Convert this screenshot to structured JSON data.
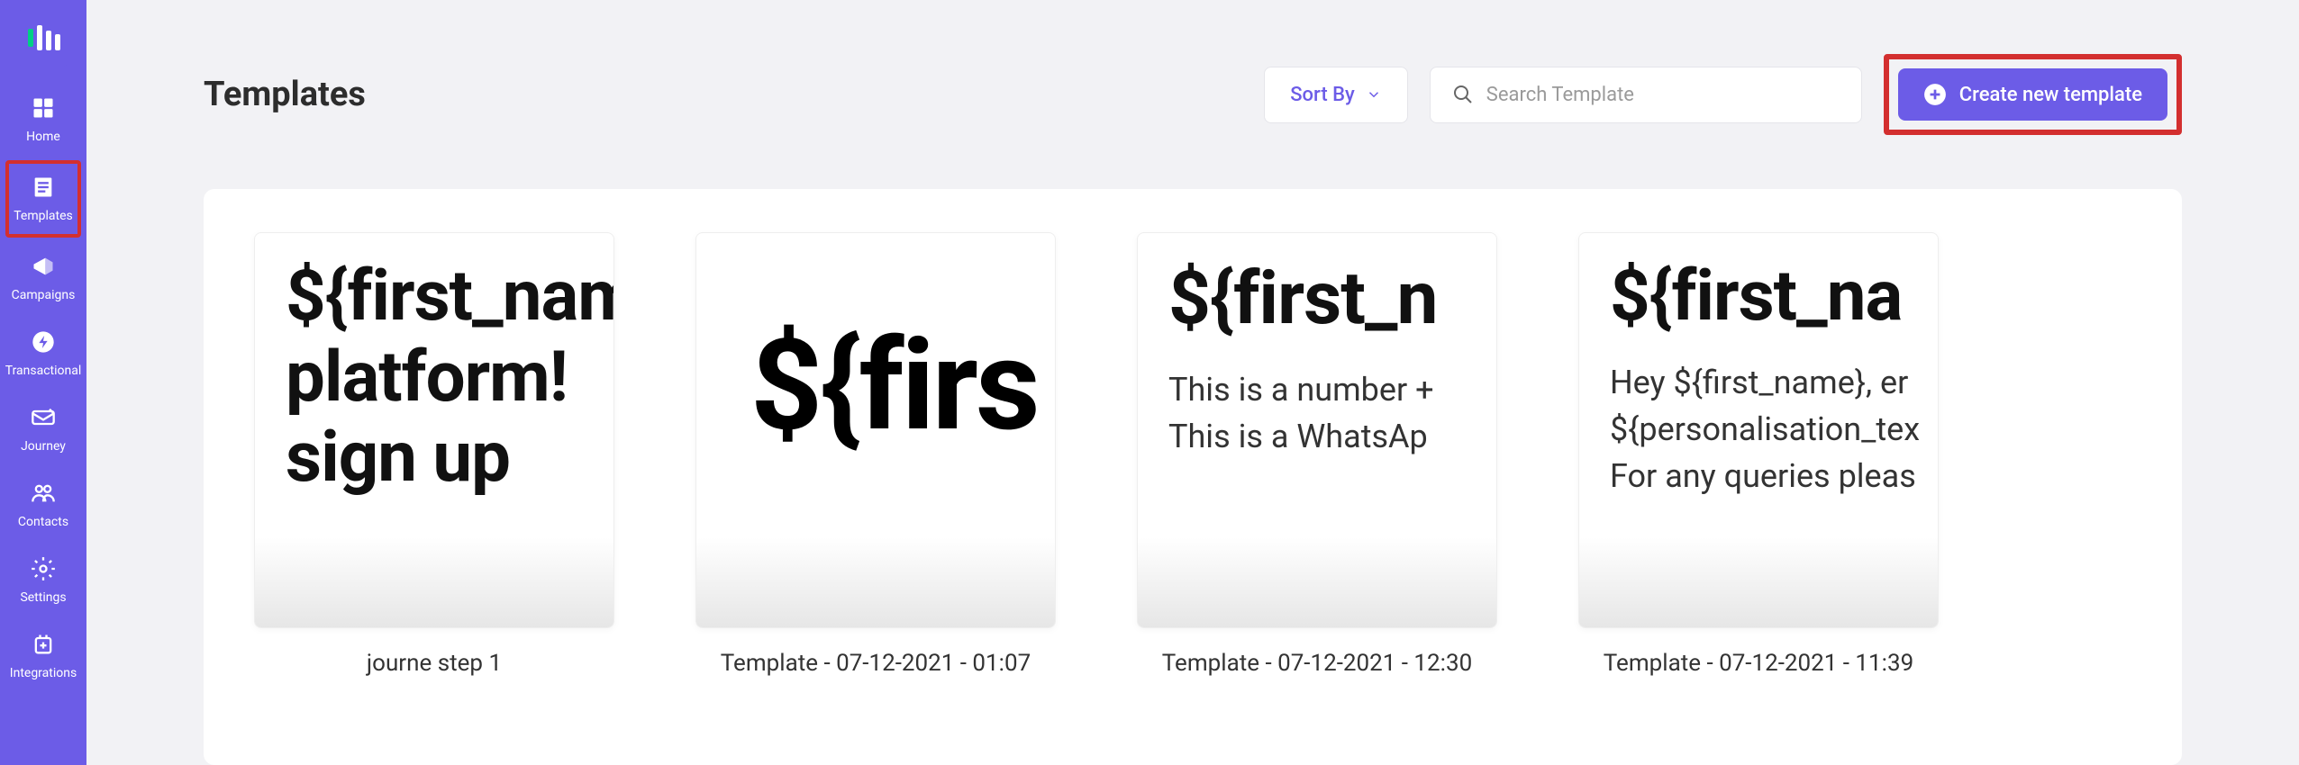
{
  "sidebar": {
    "items": [
      {
        "label": "Home"
      },
      {
        "label": "Templates"
      },
      {
        "label": "Campaigns"
      },
      {
        "label": "Transactional"
      },
      {
        "label": "Journey"
      },
      {
        "label": "Contacts"
      },
      {
        "label": "Settings"
      },
      {
        "label": "Integrations"
      }
    ]
  },
  "header": {
    "title": "Templates",
    "sort_label": "Sort By",
    "search_placeholder": "Search Template",
    "create_label": "Create new template"
  },
  "templates": [
    {
      "title": "journe step 1",
      "preview_big": "${first_name}\nplatform!\nsign up"
    },
    {
      "title": "Template - 07-12-2021 - 01:07",
      "preview_huge": "${firs"
    },
    {
      "title": "Template - 07-12-2021 - 12:30",
      "preview_big_one": "${first_n",
      "preview_body": "This is a number +\nThis is a WhatsAp"
    },
    {
      "title": "Template - 07-12-2021 - 11:39",
      "preview_big_one": "${first_na",
      "preview_body": "Hey ${first_name}, er\n${personalisation_tex\nFor any queries pleas"
    }
  ]
}
